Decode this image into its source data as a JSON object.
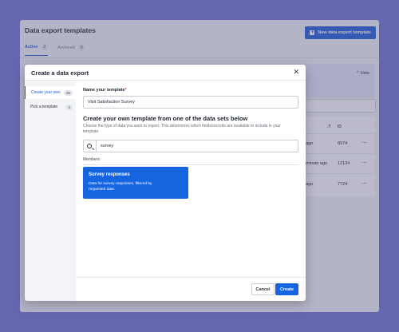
{
  "background_page": {
    "title": "Data export templates",
    "new_button_label": "New data export template",
    "tabs": [
      {
        "label": "Active",
        "count": "2"
      },
      {
        "label": "Archived",
        "count": "0"
      }
    ],
    "hide_label": "Hide",
    "table": {
      "sort_header": "↓T",
      "id_header": "ID",
      "rows": [
        {
          "updated": "ago",
          "id": "8974"
        },
        {
          "updated": "minute ago",
          "id": "12134"
        },
        {
          "updated": "ago",
          "id": "7724"
        }
      ],
      "more_icon": "⋯"
    }
  },
  "modal": {
    "title": "Create a data export",
    "close_icon": "✕",
    "sidebar": [
      {
        "label": "Create your own",
        "count": "35"
      },
      {
        "label": "Pick a template",
        "count": "4"
      }
    ],
    "name_label": "Name your template",
    "required_mark": "*",
    "name_value": "Visit Satisfaction Survey",
    "section_title": "Create your own template from one of the data sets below",
    "section_description": "Choose the type of data you want to export. This determines which fields/records are available to include in your template.",
    "search_value": "survey",
    "group_label": "Members",
    "dataset_card": {
      "title": "Survey responses",
      "description": "Data for survey responses, filtered by requested date."
    },
    "cancel_label": "Cancel",
    "create_label": "Create"
  },
  "colors": {
    "backdrop": "#6f6fd0",
    "primary": "#1565e0",
    "accent_blue": "#1d5bd8"
  }
}
